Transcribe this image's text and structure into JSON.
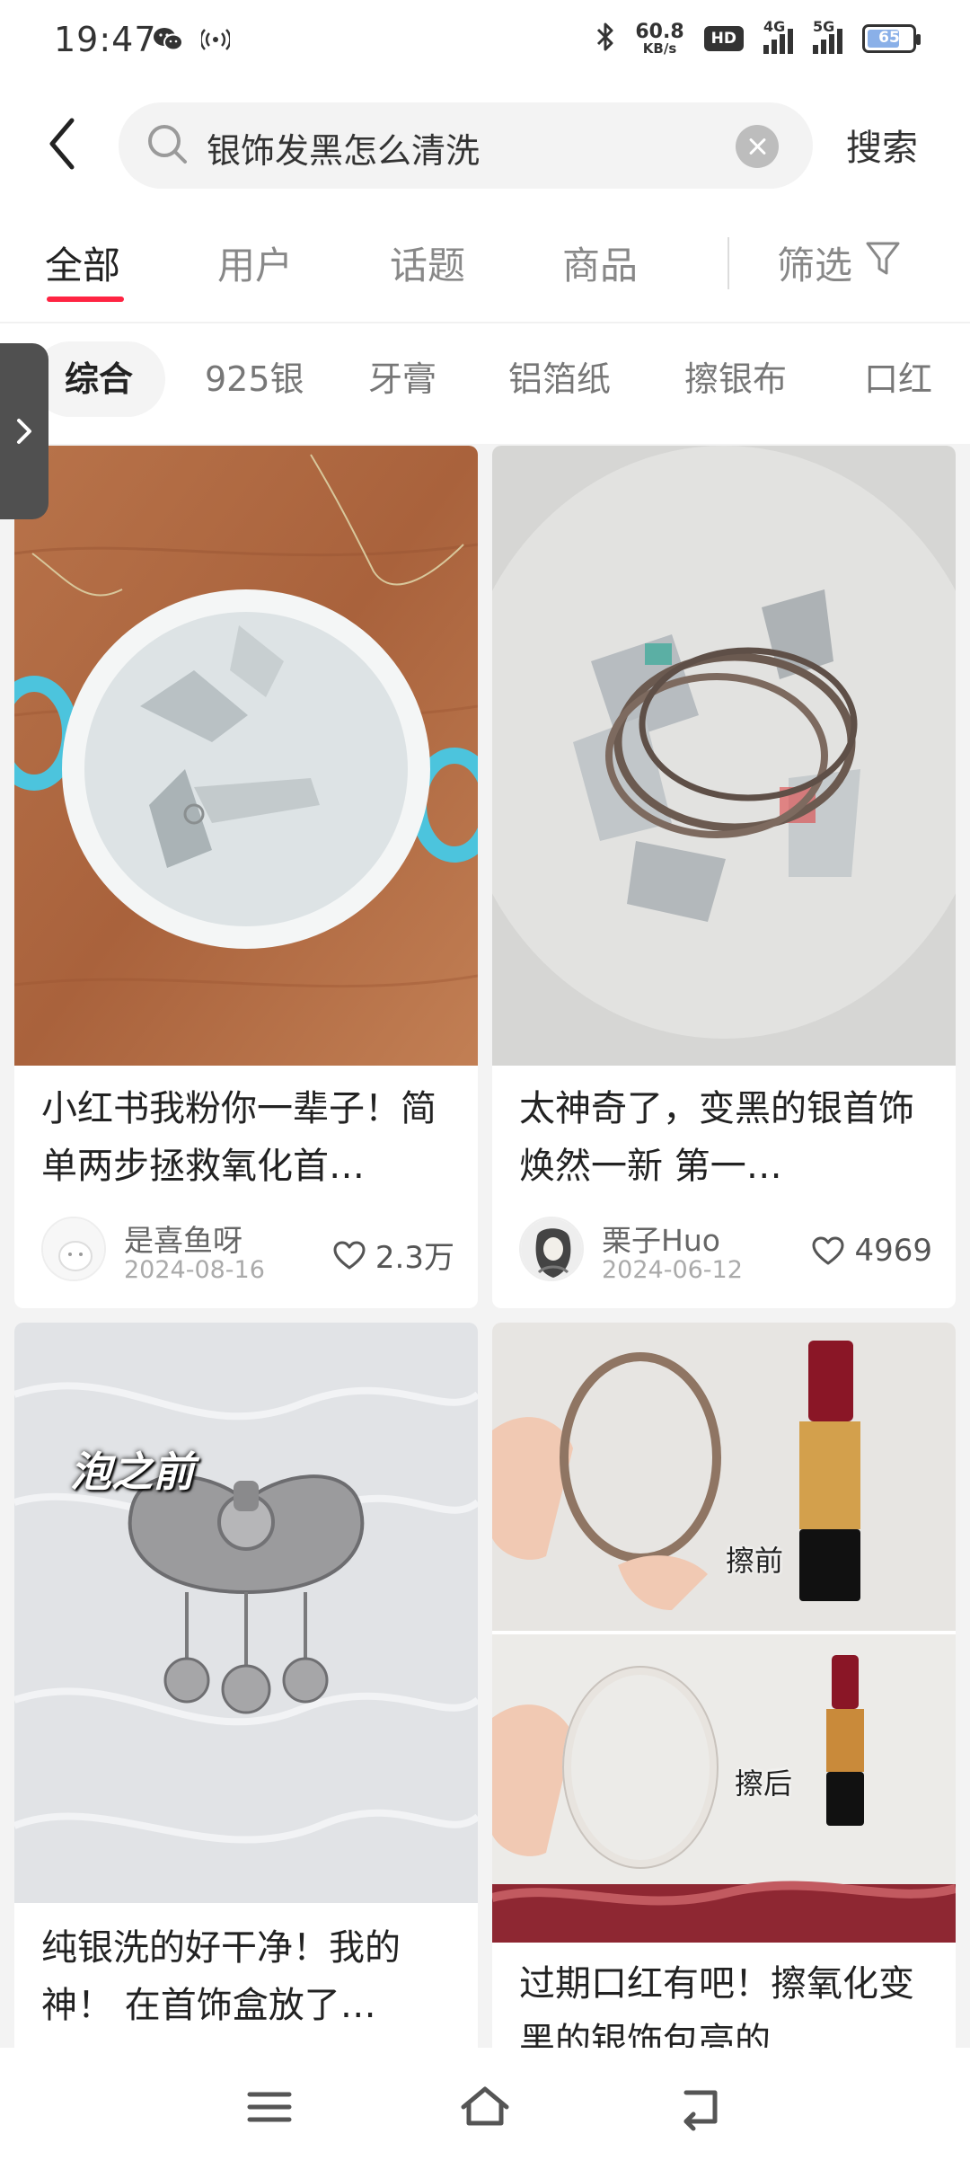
{
  "status_bar": {
    "time": "19:47",
    "net_speed_value": "60.8",
    "net_speed_unit": "KB/s",
    "hd_badge": "HD",
    "signal_1_label": "4G",
    "signal_2_label": "5G",
    "battery_level": "65"
  },
  "search": {
    "query": "银饰发黑怎么清洗",
    "submit_label": "搜索"
  },
  "tabs": {
    "all": "全部",
    "users": "用户",
    "topics": "话题",
    "products": "商品",
    "filter": "筛选"
  },
  "chips": [
    "综合",
    "925银",
    "牙膏",
    "铝箔纸",
    "擦银布",
    "口红"
  ],
  "cards": [
    {
      "title": "小红书我粉你一辈子！简单两步拯救氧化首…",
      "author": "是喜鱼呀",
      "date": "2024-08-16",
      "likes": "2.3万"
    },
    {
      "title": "太神奇了，变黑的银首饰焕然一新 第一…",
      "author": "栗子Huo",
      "date": "2024-06-12",
      "likes": "4969"
    },
    {
      "title": "纯银洗的好干净！我的神！ 在首饰盒放了…",
      "image_caption": "泡之前"
    },
    {
      "title": "过期口红有吧！擦氧化变黑的银饰包亮的…",
      "image_caption_before": "擦前",
      "image_caption_after": "擦后"
    }
  ],
  "colors": {
    "accent": "#ff2442",
    "feed_background": "#f3f3f3"
  },
  "icons": {
    "back": "chevron-left-icon",
    "search": "magnifier-icon",
    "clear": "close-circle-icon",
    "filter": "funnel-icon",
    "like": "heart-outline-icon",
    "nav_menu": "menu-icon",
    "nav_home": "home-icon",
    "nav_back": "return-icon"
  }
}
